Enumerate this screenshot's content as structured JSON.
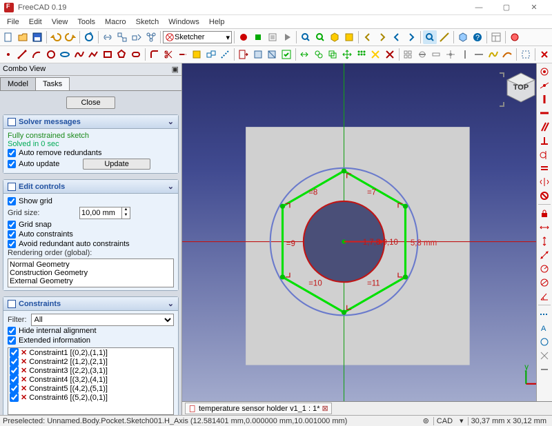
{
  "window": {
    "title": "FreeCAD 0.19"
  },
  "menu": [
    "File",
    "Edit",
    "View",
    "Tools",
    "Macro",
    "Sketch",
    "Windows",
    "Help"
  ],
  "workbench": {
    "selected": "Sketcher"
  },
  "combo": {
    "title": "Combo View",
    "tabs": [
      "Model",
      "Tasks"
    ],
    "active_tab": 1,
    "close_label": "Close",
    "solver": {
      "title": "Solver messages",
      "msg1": "Fully constrained sketch",
      "msg2": "Solved in 0 sec",
      "auto_remove": "Auto remove redundants",
      "auto_update": "Auto update",
      "update_btn": "Update"
    },
    "edit": {
      "title": "Edit controls",
      "show_grid": "Show grid",
      "grid_size_label": "Grid size:",
      "grid_size_value": "10,00 mm",
      "grid_snap": "Grid snap",
      "auto_constraints": "Auto constraints",
      "avoid_redundant": "Avoid redundant auto constraints",
      "render_order_label": "Rendering order (global):",
      "render_order": [
        "Normal Geometry",
        "Construction Geometry",
        "External Geometry"
      ]
    },
    "constraints": {
      "title": "Constraints",
      "filter_label": "Filter:",
      "filter_value": "All",
      "hide_internal": "Hide internal alignment",
      "extended": "Extended information",
      "list": [
        "Constraint1 [(0,2),(1,1)]",
        "Constraint2 [(1,2),(2,1)]",
        "Constraint3 [(2,2),(3,1)]",
        "Constraint4 [(3,2),(4,1)]",
        "Constraint5 [(4,2),(5,1)]",
        "Constraint6 [(5,2),(0,1)]"
      ]
    }
  },
  "sketch": {
    "dimension_label": "5,8 mm",
    "constraint_tags": [
      "=7",
      "=8",
      "=9",
      "=10",
      "=11"
    ],
    "center_tag": "1,7,8,9,10",
    "navcube_face": "TOP"
  },
  "doc_tab": {
    "label": "temperature sensor holder v1_1 : 1*"
  },
  "status": {
    "preselected": "Preselected: Unnamed.Body.Pocket.Sketch001.H_Axis (12.581401 mm,0.000000 mm,10.001000 mm)",
    "mode": "CAD",
    "coords": "30,37 mm x 30,12 mm"
  }
}
